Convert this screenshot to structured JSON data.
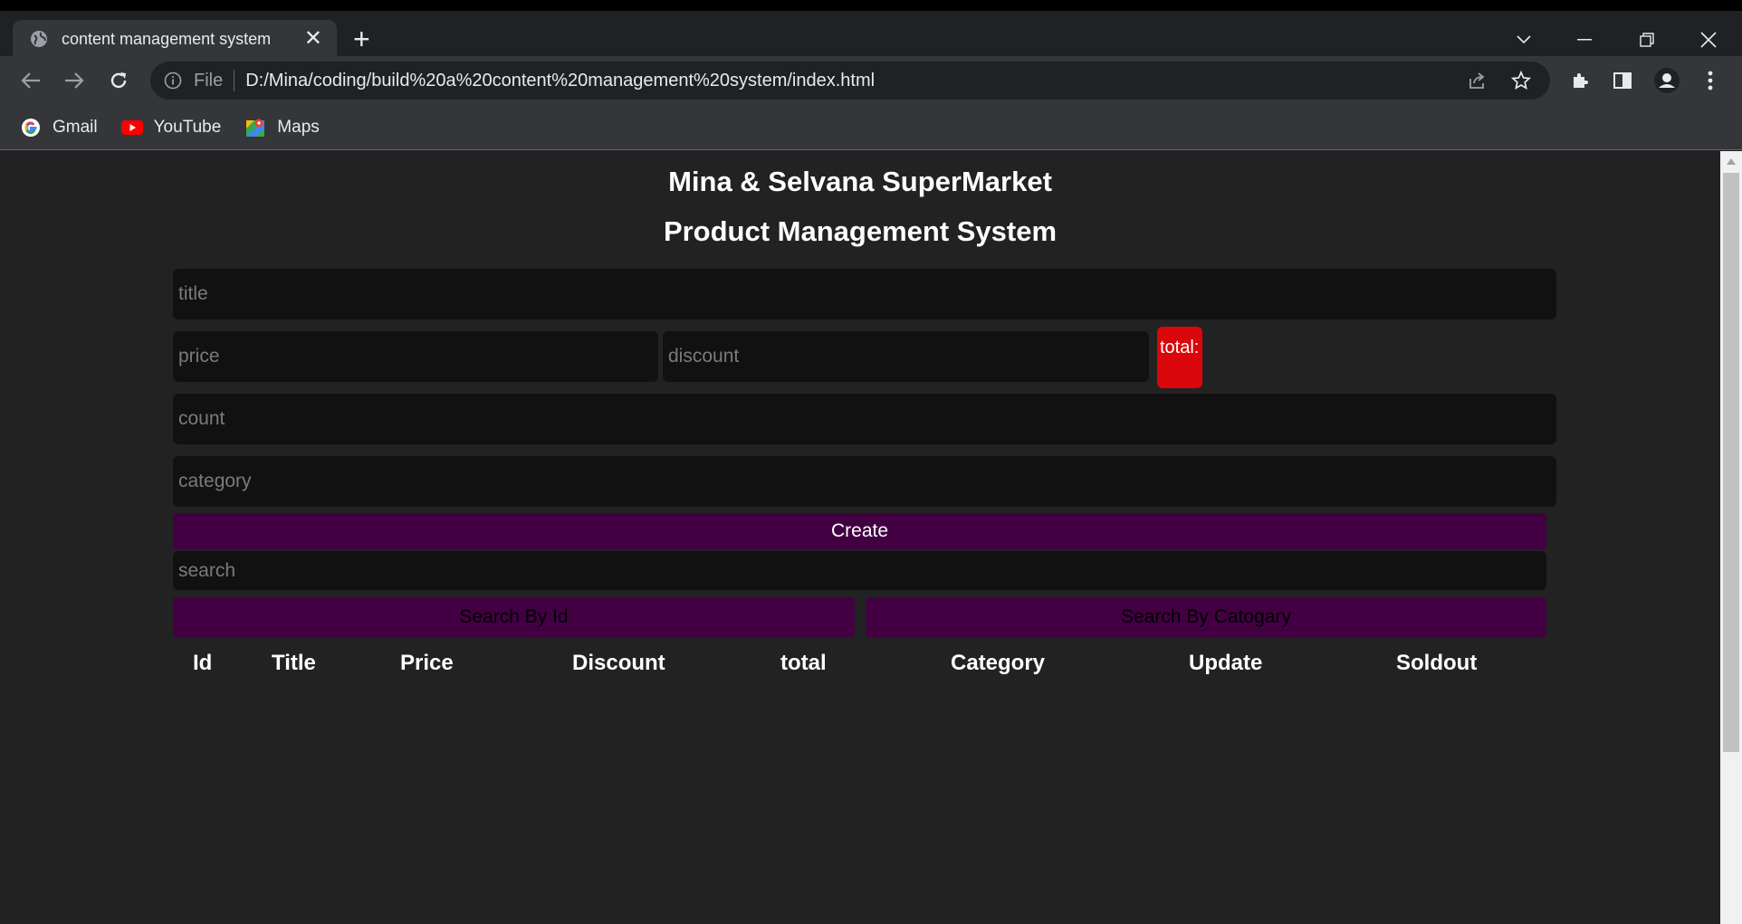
{
  "browser": {
    "tab_title": "content management system",
    "address_scheme": "File",
    "address_url": "D:/Mina/coding/build%20a%20content%20management%20system/index.html",
    "bookmarks": [
      {
        "label": "Gmail",
        "icon": "google-icon"
      },
      {
        "label": "YouTube",
        "icon": "youtube-icon"
      },
      {
        "label": "Maps",
        "icon": "maps-icon"
      }
    ]
  },
  "page": {
    "store_name": "Mina & Selvana SuperMarket",
    "system_title": "Product Management System",
    "inputs": {
      "title_placeholder": "title",
      "price_placeholder": "price",
      "discount_placeholder": "discount",
      "count_placeholder": "count",
      "category_placeholder": "category",
      "search_placeholder": "search"
    },
    "total_label": "total:",
    "create_label": "Create",
    "search_by_id_label": "Search By Id",
    "search_by_category_label": "Search By Catogary",
    "table_headers": [
      "Id",
      "Title",
      "Price",
      "Discount",
      "total",
      "Category",
      "Update",
      "Soldout"
    ]
  },
  "colors": {
    "page_bg": "#222222",
    "input_bg": "#111111",
    "button_bg": "#420042",
    "total_bg": "#d9070a"
  }
}
